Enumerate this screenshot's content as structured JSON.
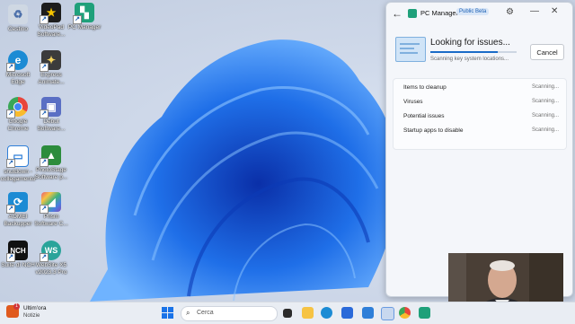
{
  "desktop": {
    "icons": [
      {
        "label": "Cestino",
        "icon": "recycle-bin-icon",
        "color": "#cfd8e3"
      },
      {
        "label": "VideoPad Software...",
        "icon": "videopad-icon",
        "color": "#1d1d1d"
      },
      {
        "label": "PC Manager",
        "icon": "pc-manager-icon",
        "color": "#1fa07a"
      },
      {
        "label": "Microsoft Edge",
        "icon": "edge-icon",
        "color": "#1c8bd4"
      },
      {
        "label": "Express Animate...",
        "icon": "express-animate-icon",
        "color": "#3b3b3b"
      },
      {
        "label": "Google Chrome",
        "icon": "chrome-icon",
        "color": "#e8453c"
      },
      {
        "label": "Debut Software...",
        "icon": "debut-icon",
        "color": "#5a6fc4"
      },
      {
        "label": "shutdown - collegamento",
        "icon": "shutdown-icon",
        "color": "#2f7fd8"
      },
      {
        "label": "PhotoStage Software p...",
        "icon": "photostage-icon",
        "color": "#2c8c3c"
      },
      {
        "label": "AOMEI Backupper",
        "icon": "aomei-icon",
        "color": "#1c8bd4"
      },
      {
        "label": "Prism Software C...",
        "icon": "prism-icon",
        "color": "#7c4dbb"
      },
      {
        "label": "Suite di NCH",
        "icon": "nch-suite-icon",
        "color": "#111111"
      },
      {
        "label": "WebSite X5 v2023.3 Pro",
        "icon": "website-x5-icon",
        "color": "#2aa49a"
      }
    ]
  },
  "pc_manager": {
    "title": "PC Manager",
    "badge": "Public Beta",
    "scan_title": "Looking for issues...",
    "scan_subtitle": "Scanning key system locations...",
    "progress": 0.78,
    "cancel_label": "Cancel",
    "items": [
      {
        "name": "Items to cleanup",
        "state": "Scanning..."
      },
      {
        "name": "Viruses",
        "state": "Scanning..."
      },
      {
        "name": "Potential issues",
        "state": "Scanning..."
      },
      {
        "name": "Startup apps to disable",
        "state": "Scanning..."
      }
    ]
  },
  "taskbar": {
    "weather_title": "Ultim'ora",
    "weather_sub": "Notizie",
    "weather_badge": "1",
    "search_placeholder": "Cerca",
    "pinned_icons": [
      "task-view-icon",
      "file-explorer-icon",
      "edge-icon",
      "store-icon",
      "mail-icon",
      "photos-icon",
      "chrome-icon",
      "pc-manager-icon"
    ]
  },
  "colors": {
    "accent": "#1a6cc7",
    "wallpaper_bloom": "#1f6fe8"
  }
}
